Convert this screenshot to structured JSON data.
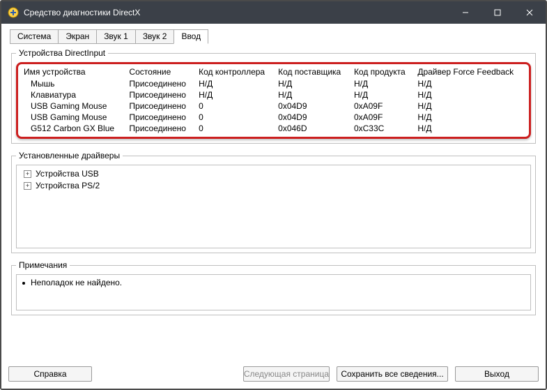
{
  "window": {
    "title": "Средство диагностики DirectX"
  },
  "tabs": {
    "items": [
      {
        "label": "Система"
      },
      {
        "label": "Экран"
      },
      {
        "label": "Звук 1"
      },
      {
        "label": "Звук 2"
      },
      {
        "label": "Ввод"
      }
    ],
    "active_index": 4
  },
  "group_devices": {
    "legend": "Устройства DirectInput",
    "columns": {
      "c0": "Имя устройства",
      "c1": "Состояние",
      "c2": "Код контроллера",
      "c3": "Код поставщика",
      "c4": "Код продукта",
      "c5": "Драйвер Force Feedback"
    },
    "rows": [
      {
        "c0": "Мышь",
        "c1": "Присоединено",
        "c2": "Н/Д",
        "c3": "Н/Д",
        "c4": "Н/Д",
        "c5": "Н/Д"
      },
      {
        "c0": "Клавиатура",
        "c1": "Присоединено",
        "c2": "Н/Д",
        "c3": "Н/Д",
        "c4": "Н/Д",
        "c5": "Н/Д"
      },
      {
        "c0": "USB Gaming Mouse",
        "c1": "Присоединено",
        "c2": "0",
        "c3": "0x04D9",
        "c4": "0xA09F",
        "c5": "Н/Д"
      },
      {
        "c0": "USB Gaming Mouse",
        "c1": "Присоединено",
        "c2": "0",
        "c3": "0x04D9",
        "c4": "0xA09F",
        "c5": "Н/Д"
      },
      {
        "c0": "G512 Carbon GX Blue",
        "c1": "Присоединено",
        "c2": "0",
        "c3": "0x046D",
        "c4": "0xC33C",
        "c5": "Н/Д"
      }
    ]
  },
  "group_drivers": {
    "legend": "Установленные драйверы",
    "items": [
      {
        "label": "Устройства USB"
      },
      {
        "label": "Устройства PS/2"
      }
    ]
  },
  "group_notes": {
    "legend": "Примечания",
    "text": "Неполадок не найдено."
  },
  "buttons": {
    "help": "Справка",
    "next": "Следующая страница",
    "save": "Сохранить все сведения...",
    "exit": "Выход"
  }
}
